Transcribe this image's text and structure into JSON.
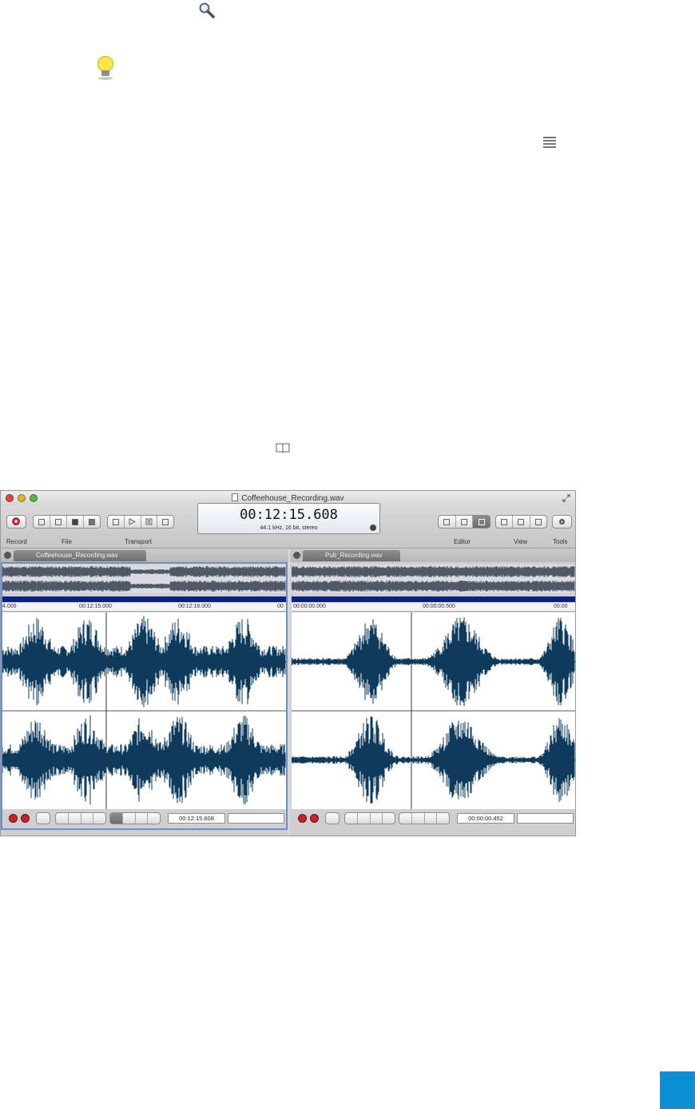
{
  "window": {
    "title": "Coffeehouse_Recording.wav",
    "display": {
      "time": "00:12:15.608",
      "format": "44.1 kHz, 16 bit, stereo"
    },
    "toolbar_labels": {
      "record": "Record",
      "file": "File",
      "transport": "Transport",
      "editor": "Editor",
      "view": "View",
      "tools": "Tools"
    }
  },
  "left_pane": {
    "tab": "Coffeehouse_Recording.wav",
    "ruler": [
      "4.000",
      "00:12:15.000",
      "00:12:16.000",
      "00"
    ],
    "position": "00:12:15.608"
  },
  "right_pane": {
    "tab": "Pub_Recording.wav",
    "ruler": [
      "00:00:00.000",
      "00:00:00.500",
      "00:00"
    ],
    "position": "00:00:00.452"
  },
  "icons": {
    "search": "search-icon",
    "tip": "lightbulb-icon",
    "menu": "menu-icon",
    "book": "book-icon"
  },
  "colors": {
    "waveform": "#0e3b5b",
    "accent_square": "#0d8fd6",
    "selection_bar": "#0b1f8c"
  }
}
